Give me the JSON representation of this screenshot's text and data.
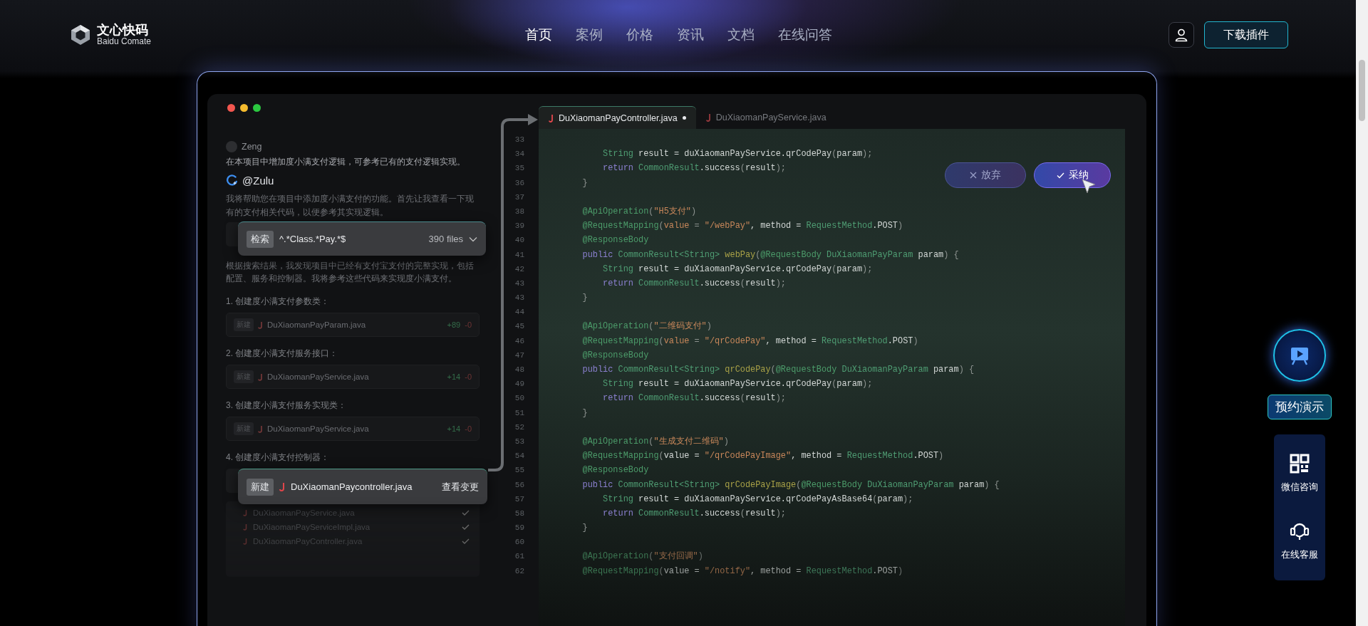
{
  "header": {
    "logo": {
      "name": "文心快码",
      "subtitle": "Baidu Comate"
    },
    "nav": [
      {
        "label": "首页",
        "selected": true
      },
      {
        "label": "案例",
        "selected": false
      },
      {
        "label": "价格",
        "selected": false
      },
      {
        "label": "资讯",
        "selected": false
      },
      {
        "label": "文档",
        "selected": false
      },
      {
        "label": "在线问答",
        "selected": false
      }
    ],
    "download_button": "下载插件"
  },
  "chat": {
    "user": "Zeng",
    "user_message": "在本项目中增加度小满支付逻辑，可参考已有的支付逻辑实现。",
    "assistant": "@Zulu",
    "assistant_intro": "我将帮助您在项目中添加度小满支付的功能。首先让我查看一下现有的支付相关代码，以便参考其实现逻辑。",
    "search": {
      "tag": "检索",
      "query": "^.*Class.*Pay.*$",
      "count": "390 files"
    },
    "analysis": "根据搜索结果，我发现项目中已经有支付宝支付的完整实现，包括配置、服务和控制器。我将参考这些代码来实现度小满支付。",
    "steps": [
      {
        "kind": "file",
        "title": "1. 创建度小满支付参数类：",
        "tag": "新建",
        "file": "DuXiaomanPayParam.java",
        "added": "+89",
        "removed": "-0"
      },
      {
        "kind": "file",
        "title": "2. 创建度小满支付服务接口：",
        "tag": "新建",
        "file": "DuXiaomanPayService.java",
        "added": "+14",
        "removed": "-0"
      },
      {
        "kind": "file",
        "title": "3. 创建度小满支付服务实现类：",
        "tag": "新建",
        "file": "DuXiaomanPayService.java",
        "added": "+14",
        "removed": "-0"
      },
      {
        "kind": "popup",
        "title": "4. 创建度小满支付控制器：",
        "tag": "新建",
        "file": "DuXiaomanPaycontroller.java",
        "action": "查看变更"
      }
    ],
    "changed_files": [
      {
        "name": "DuXiaomanPayService.java",
        "checked": true
      },
      {
        "name": "DuXiaomanPayServiceImpl.java",
        "checked": true
      },
      {
        "name": "DuXiaomanPayController.java",
        "checked": true
      }
    ]
  },
  "editor": {
    "tabs": [
      {
        "label": "DuXiaomanPayController.java",
        "selected": true,
        "modified": true
      },
      {
        "label": "DuXiaomanPayService.java",
        "selected": false,
        "modified": false
      }
    ],
    "lines": [
      {
        "num": "33"
      },
      {
        "num": "34",
        "tokens": [
          {
            "kind": "type",
            "text": "        String"
          },
          {
            "kind": "plain",
            "text": " result = duXiaomanPayService.qrCodePay"
          },
          {
            "kind": "punct",
            "text": "("
          },
          {
            "kind": "plain",
            "text": "param"
          },
          {
            "kind": "punct",
            "text": ");"
          }
        ]
      },
      {
        "num": "35",
        "tokens": [
          {
            "kind": "keyword",
            "text": "        return"
          },
          {
            "kind": "type",
            "text": " CommonResult"
          },
          {
            "kind": "plain",
            "text": ".success"
          },
          {
            "kind": "punct",
            "text": "("
          },
          {
            "kind": "plain",
            "text": "result"
          },
          {
            "kind": "punct",
            "text": ");"
          }
        ]
      },
      {
        "num": "36",
        "tokens": [
          {
            "kind": "punct",
            "text": "    }"
          }
        ]
      },
      {
        "num": "37"
      },
      {
        "num": "38",
        "tokens": [
          {
            "kind": "annotation",
            "text": "    @ApiOperation"
          },
          {
            "kind": "punct",
            "text": "("
          },
          {
            "kind": "string",
            "text": "\"H5支付\""
          },
          {
            "kind": "punct",
            "text": ")"
          }
        ]
      },
      {
        "num": "39",
        "tokens": [
          {
            "kind": "annotation",
            "text": "    @RequestMapping"
          },
          {
            "kind": "punct",
            "text": "("
          },
          {
            "kind": "string",
            "text": "value"
          },
          {
            "kind": "punct",
            "text": " = "
          },
          {
            "kind": "string",
            "text": "\"/webPay\""
          },
          {
            "kind": "plain",
            "text": ", method = "
          },
          {
            "kind": "type",
            "text": "RequestMethod"
          },
          {
            "kind": "plain",
            "text": ".POST"
          },
          {
            "kind": "punct",
            "text": ")"
          }
        ]
      },
      {
        "num": "40",
        "tokens": [
          {
            "kind": "annotation",
            "text": "    @ResponseBody"
          }
        ]
      },
      {
        "num": "41",
        "tokens": [
          {
            "kind": "keyword",
            "text": "    public"
          },
          {
            "kind": "type",
            "text": " CommonResult<String>"
          },
          {
            "kind": "function",
            "text": " webPay"
          },
          {
            "kind": "punct",
            "text": "("
          },
          {
            "kind": "annotation",
            "text": "@RequestBody"
          },
          {
            "kind": "type",
            "text": " DuXiaomanPayParam"
          },
          {
            "kind": "plain",
            "text": " param"
          },
          {
            "kind": "punct",
            "text": ") {"
          }
        ]
      },
      {
        "num": "42",
        "tokens": [
          {
            "kind": "type",
            "text": "        String"
          },
          {
            "kind": "plain",
            "text": " result = duXiaomanPayService.qrCodePay"
          },
          {
            "kind": "punct",
            "text": "("
          },
          {
            "kind": "plain",
            "text": "param"
          },
          {
            "kind": "punct",
            "text": ");"
          }
        ]
      },
      {
        "num": "43",
        "tokens": [
          {
            "kind": "keyword",
            "text": "        return"
          },
          {
            "kind": "type",
            "text": " CommonResult"
          },
          {
            "kind": "plain",
            "text": ".success"
          },
          {
            "kind": "punct",
            "text": "("
          },
          {
            "kind": "plain",
            "text": "result"
          },
          {
            "kind": "punct",
            "text": ");"
          }
        ]
      },
      {
        "num": "43",
        "tokens": [
          {
            "kind": "punct",
            "text": "    }"
          }
        ]
      },
      {
        "num": "44"
      },
      {
        "num": "45",
        "tokens": [
          {
            "kind": "annotation",
            "text": "    @ApiOperation"
          },
          {
            "kind": "punct",
            "text": "("
          },
          {
            "kind": "string",
            "text": "\"二维码支付\""
          },
          {
            "kind": "punct",
            "text": ")"
          }
        ]
      },
      {
        "num": "46",
        "tokens": [
          {
            "kind": "annotation",
            "text": "    @RequestMapping"
          },
          {
            "kind": "punct",
            "text": "("
          },
          {
            "kind": "string",
            "text": "value"
          },
          {
            "kind": "punct",
            "text": " = "
          },
          {
            "kind": "string",
            "text": "\"/qrCodePay\""
          },
          {
            "kind": "plain",
            "text": ", method = "
          },
          {
            "kind": "type",
            "text": "RequestMethod"
          },
          {
            "kind": "plain",
            "text": ".POST"
          },
          {
            "kind": "punct",
            "text": ")"
          }
        ]
      },
      {
        "num": "47",
        "tokens": [
          {
            "kind": "annotation",
            "text": "    @ResponseBody"
          }
        ]
      },
      {
        "num": "48",
        "tokens": [
          {
            "kind": "keyword",
            "text": "    public"
          },
          {
            "kind": "type",
            "text": " CommonResult<String>"
          },
          {
            "kind": "function",
            "text": " qrCodePay"
          },
          {
            "kind": "punct",
            "text": "("
          },
          {
            "kind": "annotation",
            "text": "@RequestBody"
          },
          {
            "kind": "type",
            "text": " DuXiaomanPayParam"
          },
          {
            "kind": "plain",
            "text": " param"
          },
          {
            "kind": "punct",
            "text": ") {"
          }
        ]
      },
      {
        "num": "49",
        "tokens": [
          {
            "kind": "type",
            "text": "        String"
          },
          {
            "kind": "plain",
            "text": " result = duXiaomanPayService.qrCodePay"
          },
          {
            "kind": "punct",
            "text": "("
          },
          {
            "kind": "plain",
            "text": "param"
          },
          {
            "kind": "punct",
            "text": ");"
          }
        ]
      },
      {
        "num": "50",
        "tokens": [
          {
            "kind": "keyword",
            "text": "        return"
          },
          {
            "kind": "type",
            "text": " CommonResult"
          },
          {
            "kind": "plain",
            "text": ".success"
          },
          {
            "kind": "punct",
            "text": "("
          },
          {
            "kind": "plain",
            "text": "result"
          },
          {
            "kind": "punct",
            "text": ");"
          }
        ]
      },
      {
        "num": "51",
        "tokens": [
          {
            "kind": "punct",
            "text": "    }"
          }
        ]
      },
      {
        "num": "52"
      },
      {
        "num": "53",
        "tokens": [
          {
            "kind": "annotation",
            "text": "    @ApiOperation"
          },
          {
            "kind": "punct",
            "text": "("
          },
          {
            "kind": "string",
            "text": "\"生成支付二维码\""
          },
          {
            "kind": "punct",
            "text": ")"
          }
        ]
      },
      {
        "num": "54",
        "tokens": [
          {
            "kind": "annotation",
            "text": "    @RequestMapping"
          },
          {
            "kind": "punct",
            "text": "("
          },
          {
            "kind": "plain",
            "text": "value = "
          },
          {
            "kind": "string",
            "text": "\"/qrCodePayImage\""
          },
          {
            "kind": "plain",
            "text": ", method = "
          },
          {
            "kind": "type",
            "text": "RequestMethod"
          },
          {
            "kind": "plain",
            "text": ".POST"
          },
          {
            "kind": "punct",
            "text": ")"
          }
        ]
      },
      {
        "num": "55",
        "tokens": [
          {
            "kind": "annotation",
            "text": "    @ResponseBody"
          }
        ]
      },
      {
        "num": "56",
        "tokens": [
          {
            "kind": "keyword",
            "text": "    public"
          },
          {
            "kind": "type",
            "text": " CommonResult<String>"
          },
          {
            "kind": "function",
            "text": " qrCodePayImage"
          },
          {
            "kind": "punct",
            "text": "("
          },
          {
            "kind": "annotation",
            "text": "@RequestBody"
          },
          {
            "kind": "type",
            "text": " DuXiaomanPayParam"
          },
          {
            "kind": "plain",
            "text": " param"
          },
          {
            "kind": "punct",
            "text": ") {"
          }
        ]
      },
      {
        "num": "57",
        "tokens": [
          {
            "kind": "type",
            "text": "        String"
          },
          {
            "kind": "plain",
            "text": " result = duXiaomanPayService.qrCodePayAsBase64"
          },
          {
            "kind": "punct",
            "text": "("
          },
          {
            "kind": "plain",
            "text": "param"
          },
          {
            "kind": "punct",
            "text": ");"
          }
        ]
      },
      {
        "num": "58",
        "tokens": [
          {
            "kind": "keyword",
            "text": "        return"
          },
          {
            "kind": "type",
            "text": " CommonResult"
          },
          {
            "kind": "plain",
            "text": ".success"
          },
          {
            "kind": "punct",
            "text": "("
          },
          {
            "kind": "plain",
            "text": "result"
          },
          {
            "kind": "punct",
            "text": ");"
          }
        ]
      },
      {
        "num": "59",
        "tokens": [
          {
            "kind": "punct",
            "text": "    }"
          }
        ]
      },
      {
        "num": "60"
      },
      {
        "num": "61",
        "tokens": [
          {
            "kind": "annotation",
            "text": "    @ApiOperation"
          },
          {
            "kind": "punct",
            "text": "("
          },
          {
            "kind": "string",
            "text": "\"支付回调\""
          },
          {
            "kind": "punct",
            "text": ")"
          }
        ]
      },
      {
        "num": "62",
        "tokens": [
          {
            "kind": "annotation",
            "text": "    @RequestMapping"
          },
          {
            "kind": "punct",
            "text": "("
          },
          {
            "kind": "plain",
            "text": "value = "
          },
          {
            "kind": "string",
            "text": "\"/notify\""
          },
          {
            "kind": "plain",
            "text": ", method = "
          },
          {
            "kind": "type",
            "text": "RequestMethod"
          },
          {
            "kind": "plain",
            "text": ".POST"
          },
          {
            "kind": "punct",
            "text": ")"
          }
        ]
      }
    ],
    "actions": [
      {
        "kind": "reject",
        "label": "放弃"
      },
      {
        "kind": "accept",
        "label": "采纳"
      }
    ]
  },
  "sidebar": {
    "demo_button": "预约演示",
    "contacts": [
      {
        "kind": "wechat",
        "label": "微信咨询"
      },
      {
        "kind": "service",
        "label": "在线客服"
      }
    ]
  }
}
